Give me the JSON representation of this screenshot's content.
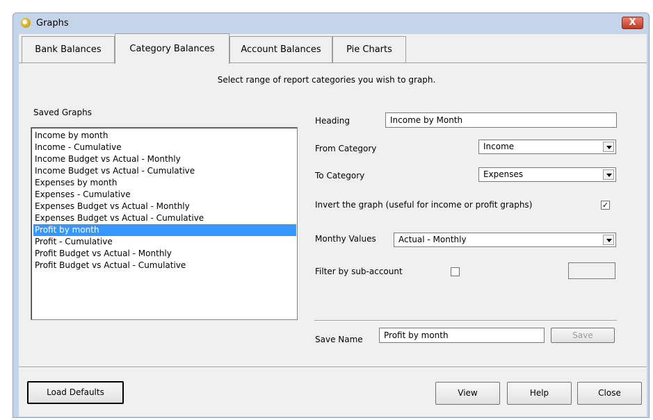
{
  "window": {
    "title": "Graphs",
    "close_label": "X"
  },
  "tabs": [
    {
      "label": "Bank Balances"
    },
    {
      "label": "Category Balances"
    },
    {
      "label": "Account Balances"
    },
    {
      "label": "Pie Charts"
    }
  ],
  "instruction": "Select range of report categories you wish to graph.",
  "saved_graphs": {
    "label": "Saved Graphs",
    "items": [
      "Income by month",
      "Income - Cumulative",
      "Income Budget vs Actual - Monthly",
      "Income Budget vs Actual - Cumulative",
      "Expenses by month",
      "Expenses - Cumulative",
      "Expenses Budget vs Actual - Monthly",
      "Expenses Budget vs Actual - Cumulative",
      "Profit by month",
      "Profit - Cumulative",
      "Profit Budget vs Actual - Monthly",
      "Profit Budget vs Actual - Cumulative"
    ],
    "selected": "Profit by month"
  },
  "form": {
    "heading_label": "Heading",
    "heading_value": "Income by Month",
    "from_category_label": "From Category",
    "from_category_value": "Income",
    "to_category_label": "To Category",
    "to_category_value": "Expenses",
    "invert_label": "Invert the graph (useful for income or profit graphs)",
    "invert_checked": true,
    "monthly_values_label": "Monthy Values",
    "monthly_values_value": "Actual - Monthly",
    "filter_label": "Filter by sub-account",
    "filter_checked": false,
    "save_name_label": "Save Name",
    "save_name_value": "Profit by month",
    "save_button": "Save"
  },
  "buttons": {
    "load_defaults": "Load Defaults",
    "view": "View",
    "help": "Help",
    "close": "Close"
  }
}
